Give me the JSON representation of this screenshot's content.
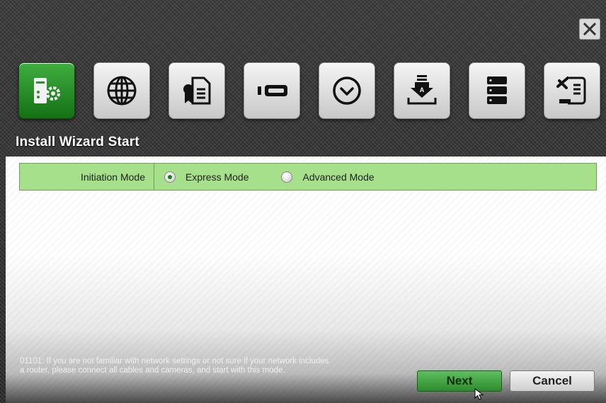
{
  "window": {
    "close_icon": "close-icon"
  },
  "wizard_steps": [
    {
      "icon": "server-settings-icon",
      "active": true
    },
    {
      "icon": "globe-icon",
      "active": false
    },
    {
      "icon": "certificate-document-icon",
      "active": false
    },
    {
      "icon": "camera-device-icon",
      "active": false
    },
    {
      "icon": "clock-icon",
      "active": false
    },
    {
      "icon": "download-tray-icon",
      "active": false
    },
    {
      "icon": "storage-drives-icon",
      "active": false
    },
    {
      "icon": "tools-scroll-icon",
      "active": false
    }
  ],
  "page": {
    "title": "Install Wizard Start"
  },
  "initiation": {
    "label": "Initiation Mode",
    "options": [
      {
        "label": "Express Mode",
        "selected": true
      },
      {
        "label": "Advanced Mode",
        "selected": false
      }
    ]
  },
  "note": {
    "text": "01101: If you are not familiar with network settings or not sure if your network includes a router, please connect all cables and cameras, and start with this mode."
  },
  "buttons": {
    "next": "Next",
    "cancel": "Cancel"
  },
  "colors": {
    "active_step": "#2e8f2e",
    "mode_row": "#a6e08a",
    "next_button": "#3c9e3c"
  }
}
